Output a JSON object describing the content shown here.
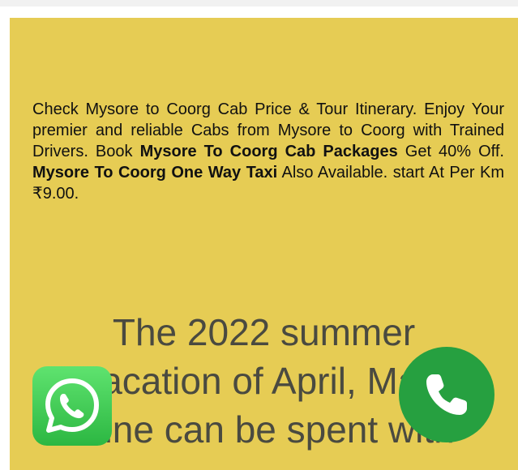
{
  "intro": {
    "part1": "Check Mysore to Coorg Cab Price & Tour Itinerary. Enjoy Your premier and reliable Cabs from Mysore to Coorg with Trained Drivers. Book ",
    "bold1": "Mysore To Coorg Cab Packages",
    "part2": " Get 40% Off. ",
    "bold2": "Mysore To Coorg One Way Taxi",
    "part3": " Also Available. start At Per Km ₹9.00."
  },
  "headline": {
    "line1": "The 2022 summer",
    "line2": "vacation of April, May,",
    "line3": "June can be spent with"
  },
  "floating_buttons": {
    "whatsapp_icon": "whatsapp-icon",
    "call_icon": "phone-icon"
  },
  "colors": {
    "panel_background": "#e6cc54",
    "whatsapp_green": "#2cb742",
    "call_green": "#26a040",
    "headline_text": "#4a4a40"
  }
}
